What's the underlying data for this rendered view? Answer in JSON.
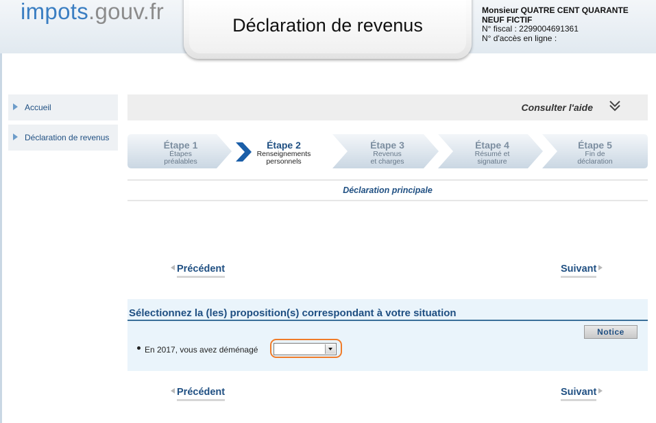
{
  "header": {
    "logo_part1": "impots",
    "logo_part2": ".gouv.fr",
    "title": "Déclaration de revenus",
    "user_name": "Monsieur QUATRE CENT QUARANTE NEUF FICTIF",
    "fiscal_number": "N° fiscal : 2299004691361",
    "online_access": "N° d'accès en ligne :"
  },
  "sidebar": {
    "items": [
      {
        "label": "Accueil"
      },
      {
        "label": "Déclaration de revenus"
      }
    ]
  },
  "help": {
    "label": "Consulter l'aide",
    "icon": "double-chevron-down-icon"
  },
  "steps": [
    {
      "title": "Étape 1",
      "line1": "Étapes",
      "line2": "préalables",
      "active": false
    },
    {
      "title": "Étape 2",
      "line1": "Renseignements",
      "line2": "personnels",
      "active": true
    },
    {
      "title": "Étape 3",
      "line1": "Revenus",
      "line2": "et charges",
      "active": false
    },
    {
      "title": "Étape 4",
      "line1": "Résumé et",
      "line2": "signature",
      "active": false
    },
    {
      "title": "Étape 5",
      "line1": "Fin de",
      "line2": "déclaration",
      "active": false
    }
  ],
  "subtitle": "Déclaration principale",
  "nav": {
    "previous": "Précédent",
    "next": "Suivant"
  },
  "question_panel": {
    "title": "Sélectionnez la (les) proposition(s) correspondant à votre situation",
    "notice_label": "Notice",
    "question": "En 2017, vous avez déménagé",
    "select_value": ""
  },
  "colors": {
    "brand_blue": "#1f4f82",
    "logo_blue": "#3a7ec2",
    "highlight_orange": "#f07b28",
    "panel_bg": "#eaf4fb"
  }
}
